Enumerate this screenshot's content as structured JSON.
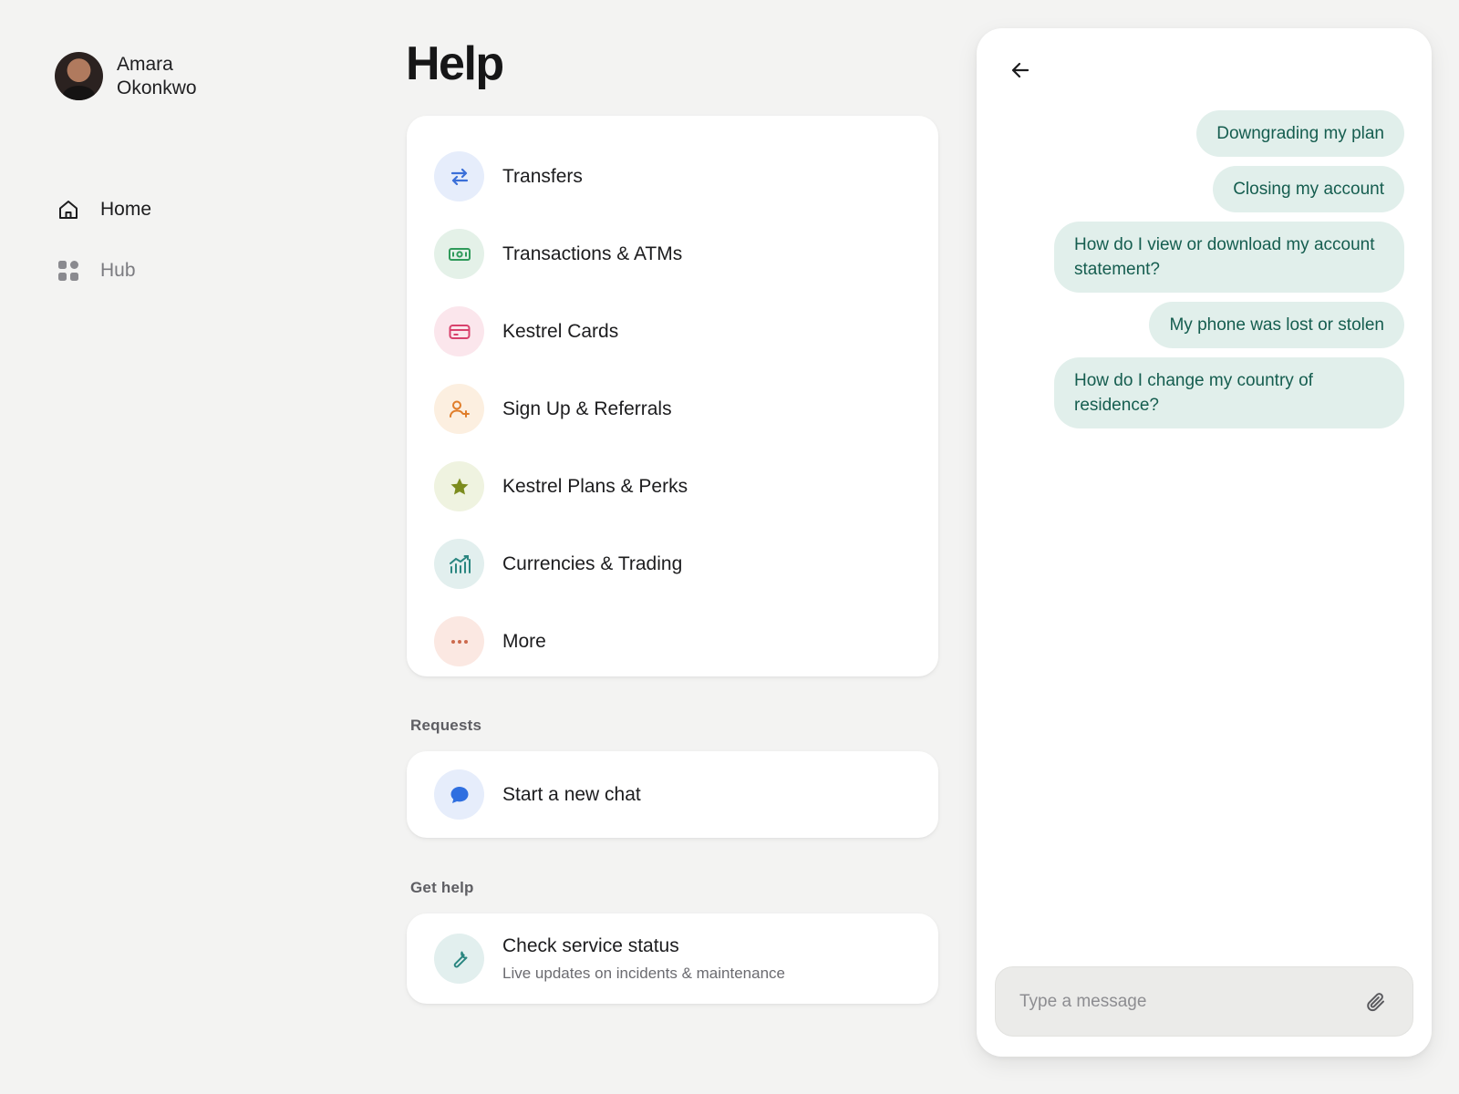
{
  "profile": {
    "first_name": "Amara",
    "last_name": "Okonkwo"
  },
  "nav": [
    {
      "label": "Home",
      "icon": "home-icon",
      "active": true
    },
    {
      "label": "Hub",
      "icon": "grid-icon",
      "active": false
    }
  ],
  "page_title": "Help",
  "topics": [
    {
      "label": "Transfers",
      "icon": "transfer-arrows-icon",
      "bg": "#e6edfb",
      "color": "#3a6fd8"
    },
    {
      "label": "Transactions & ATMs",
      "icon": "cash-icon",
      "bg": "#e4f1e8",
      "color": "#2f9a5a"
    },
    {
      "label": "Kestrel Cards",
      "icon": "card-icon",
      "bg": "#fbe6ec",
      "color": "#d8416c"
    },
    {
      "label": "Sign Up & Referrals",
      "icon": "add-user-icon",
      "bg": "#fcefe0",
      "color": "#e07d2a"
    },
    {
      "label": "Kestrel Plans & Perks",
      "icon": "star-icon",
      "bg": "#eff3e0",
      "color": "#7c8c1e"
    },
    {
      "label": "Currencies & Trading",
      "icon": "chart-icon",
      "bg": "#e2efee",
      "color": "#2a8680"
    },
    {
      "label": "More",
      "icon": "more-dots-icon",
      "bg": "#fbe8e2",
      "color": "#cc6a4d"
    }
  ],
  "requests": {
    "section_label": "Requests",
    "new_chat_label": "Start a new chat",
    "icon_bg": "#e6edfb",
    "icon_color": "#2f6fe0"
  },
  "get_help": {
    "section_label": "Get help",
    "status_title": "Check service status",
    "status_subtitle": "Live updates on incidents & maintenance",
    "icon_bg": "#e2efee",
    "icon_color": "#2a8680"
  },
  "chat": {
    "suggestions": [
      "Downgrading my plan",
      "Closing my account",
      "How do I view or download my account statement?",
      "My phone was lost or stolen",
      "How do I change my country of residence?"
    ],
    "composer_placeholder": "Type a message",
    "chip_bg": "#e1efeb",
    "chip_text": "#155d4f"
  }
}
